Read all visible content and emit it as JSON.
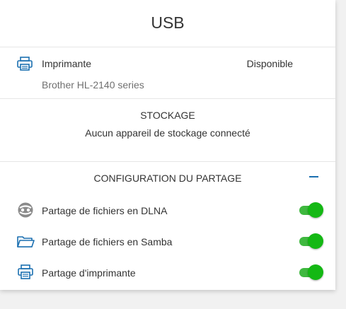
{
  "panel": {
    "title": "USB"
  },
  "printer": {
    "icon": "printer-icon",
    "name": "Imprimante",
    "status": "Disponible",
    "model": "Brother HL-2140 series"
  },
  "storage": {
    "heading": "STOCKAGE",
    "message": "Aucun appareil de stockage connecté"
  },
  "sharing": {
    "heading": "CONFIGURATION DU PARTAGE",
    "collapse_icon": "minus-icon",
    "items": [
      {
        "icon": "dlna-icon",
        "label": "Partage de fichiers en DLNA",
        "enabled": true
      },
      {
        "icon": "folder-icon",
        "label": "Partage de fichiers en Samba",
        "enabled": true
      },
      {
        "icon": "printer-icon",
        "label": "Partage d'imprimante",
        "enabled": true
      }
    ]
  },
  "colors": {
    "accent": "#1a6fb0",
    "toggle_on": "#14b814",
    "icon_gray": "#8a8a8a"
  }
}
